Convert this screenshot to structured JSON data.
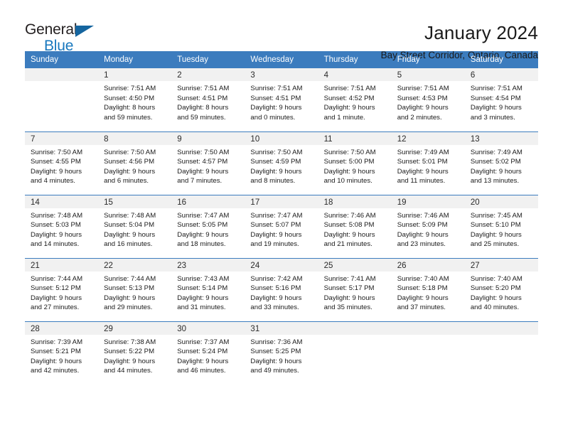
{
  "brand": {
    "name_part1": "General",
    "name_part2": "Blue",
    "triangle_color": "#15659f",
    "blue_color": "#1878be"
  },
  "header": {
    "title": "January 2024",
    "subtitle": "Bay Street Corridor, Ontario, Canada"
  },
  "theme": {
    "header_row_bg": "#3c7cbe",
    "daynum_bg": "#f1f1f1",
    "page_bg": "#ffffff"
  },
  "weekday_headers": [
    "Sunday",
    "Monday",
    "Tuesday",
    "Wednesday",
    "Thursday",
    "Friday",
    "Saturday"
  ],
  "weeks": [
    {
      "days": [
        {
          "num": "",
          "sunrise": "",
          "sunset": "",
          "daylight1": "",
          "daylight2": ""
        },
        {
          "num": "1",
          "sunrise": "Sunrise: 7:51 AM",
          "sunset": "Sunset: 4:50 PM",
          "daylight1": "Daylight: 8 hours",
          "daylight2": "and 59 minutes."
        },
        {
          "num": "2",
          "sunrise": "Sunrise: 7:51 AM",
          "sunset": "Sunset: 4:51 PM",
          "daylight1": "Daylight: 8 hours",
          "daylight2": "and 59 minutes."
        },
        {
          "num": "3",
          "sunrise": "Sunrise: 7:51 AM",
          "sunset": "Sunset: 4:51 PM",
          "daylight1": "Daylight: 9 hours",
          "daylight2": "and 0 minutes."
        },
        {
          "num": "4",
          "sunrise": "Sunrise: 7:51 AM",
          "sunset": "Sunset: 4:52 PM",
          "daylight1": "Daylight: 9 hours",
          "daylight2": "and 1 minute."
        },
        {
          "num": "5",
          "sunrise": "Sunrise: 7:51 AM",
          "sunset": "Sunset: 4:53 PM",
          "daylight1": "Daylight: 9 hours",
          "daylight2": "and 2 minutes."
        },
        {
          "num": "6",
          "sunrise": "Sunrise: 7:51 AM",
          "sunset": "Sunset: 4:54 PM",
          "daylight1": "Daylight: 9 hours",
          "daylight2": "and 3 minutes."
        }
      ]
    },
    {
      "days": [
        {
          "num": "7",
          "sunrise": "Sunrise: 7:50 AM",
          "sunset": "Sunset: 4:55 PM",
          "daylight1": "Daylight: 9 hours",
          "daylight2": "and 4 minutes."
        },
        {
          "num": "8",
          "sunrise": "Sunrise: 7:50 AM",
          "sunset": "Sunset: 4:56 PM",
          "daylight1": "Daylight: 9 hours",
          "daylight2": "and 6 minutes."
        },
        {
          "num": "9",
          "sunrise": "Sunrise: 7:50 AM",
          "sunset": "Sunset: 4:57 PM",
          "daylight1": "Daylight: 9 hours",
          "daylight2": "and 7 minutes."
        },
        {
          "num": "10",
          "sunrise": "Sunrise: 7:50 AM",
          "sunset": "Sunset: 4:59 PM",
          "daylight1": "Daylight: 9 hours",
          "daylight2": "and 8 minutes."
        },
        {
          "num": "11",
          "sunrise": "Sunrise: 7:50 AM",
          "sunset": "Sunset: 5:00 PM",
          "daylight1": "Daylight: 9 hours",
          "daylight2": "and 10 minutes."
        },
        {
          "num": "12",
          "sunrise": "Sunrise: 7:49 AM",
          "sunset": "Sunset: 5:01 PM",
          "daylight1": "Daylight: 9 hours",
          "daylight2": "and 11 minutes."
        },
        {
          "num": "13",
          "sunrise": "Sunrise: 7:49 AM",
          "sunset": "Sunset: 5:02 PM",
          "daylight1": "Daylight: 9 hours",
          "daylight2": "and 13 minutes."
        }
      ]
    },
    {
      "days": [
        {
          "num": "14",
          "sunrise": "Sunrise: 7:48 AM",
          "sunset": "Sunset: 5:03 PM",
          "daylight1": "Daylight: 9 hours",
          "daylight2": "and 14 minutes."
        },
        {
          "num": "15",
          "sunrise": "Sunrise: 7:48 AM",
          "sunset": "Sunset: 5:04 PM",
          "daylight1": "Daylight: 9 hours",
          "daylight2": "and 16 minutes."
        },
        {
          "num": "16",
          "sunrise": "Sunrise: 7:47 AM",
          "sunset": "Sunset: 5:05 PM",
          "daylight1": "Daylight: 9 hours",
          "daylight2": "and 18 minutes."
        },
        {
          "num": "17",
          "sunrise": "Sunrise: 7:47 AM",
          "sunset": "Sunset: 5:07 PM",
          "daylight1": "Daylight: 9 hours",
          "daylight2": "and 19 minutes."
        },
        {
          "num": "18",
          "sunrise": "Sunrise: 7:46 AM",
          "sunset": "Sunset: 5:08 PM",
          "daylight1": "Daylight: 9 hours",
          "daylight2": "and 21 minutes."
        },
        {
          "num": "19",
          "sunrise": "Sunrise: 7:46 AM",
          "sunset": "Sunset: 5:09 PM",
          "daylight1": "Daylight: 9 hours",
          "daylight2": "and 23 minutes."
        },
        {
          "num": "20",
          "sunrise": "Sunrise: 7:45 AM",
          "sunset": "Sunset: 5:10 PM",
          "daylight1": "Daylight: 9 hours",
          "daylight2": "and 25 minutes."
        }
      ]
    },
    {
      "days": [
        {
          "num": "21",
          "sunrise": "Sunrise: 7:44 AM",
          "sunset": "Sunset: 5:12 PM",
          "daylight1": "Daylight: 9 hours",
          "daylight2": "and 27 minutes."
        },
        {
          "num": "22",
          "sunrise": "Sunrise: 7:44 AM",
          "sunset": "Sunset: 5:13 PM",
          "daylight1": "Daylight: 9 hours",
          "daylight2": "and 29 minutes."
        },
        {
          "num": "23",
          "sunrise": "Sunrise: 7:43 AM",
          "sunset": "Sunset: 5:14 PM",
          "daylight1": "Daylight: 9 hours",
          "daylight2": "and 31 minutes."
        },
        {
          "num": "24",
          "sunrise": "Sunrise: 7:42 AM",
          "sunset": "Sunset: 5:16 PM",
          "daylight1": "Daylight: 9 hours",
          "daylight2": "and 33 minutes."
        },
        {
          "num": "25",
          "sunrise": "Sunrise: 7:41 AM",
          "sunset": "Sunset: 5:17 PM",
          "daylight1": "Daylight: 9 hours",
          "daylight2": "and 35 minutes."
        },
        {
          "num": "26",
          "sunrise": "Sunrise: 7:40 AM",
          "sunset": "Sunset: 5:18 PM",
          "daylight1": "Daylight: 9 hours",
          "daylight2": "and 37 minutes."
        },
        {
          "num": "27",
          "sunrise": "Sunrise: 7:40 AM",
          "sunset": "Sunset: 5:20 PM",
          "daylight1": "Daylight: 9 hours",
          "daylight2": "and 40 minutes."
        }
      ]
    },
    {
      "days": [
        {
          "num": "28",
          "sunrise": "Sunrise: 7:39 AM",
          "sunset": "Sunset: 5:21 PM",
          "daylight1": "Daylight: 9 hours",
          "daylight2": "and 42 minutes."
        },
        {
          "num": "29",
          "sunrise": "Sunrise: 7:38 AM",
          "sunset": "Sunset: 5:22 PM",
          "daylight1": "Daylight: 9 hours",
          "daylight2": "and 44 minutes."
        },
        {
          "num": "30",
          "sunrise": "Sunrise: 7:37 AM",
          "sunset": "Sunset: 5:24 PM",
          "daylight1": "Daylight: 9 hours",
          "daylight2": "and 46 minutes."
        },
        {
          "num": "31",
          "sunrise": "Sunrise: 7:36 AM",
          "sunset": "Sunset: 5:25 PM",
          "daylight1": "Daylight: 9 hours",
          "daylight2": "and 49 minutes."
        },
        {
          "num": "",
          "sunrise": "",
          "sunset": "",
          "daylight1": "",
          "daylight2": ""
        },
        {
          "num": "",
          "sunrise": "",
          "sunset": "",
          "daylight1": "",
          "daylight2": ""
        },
        {
          "num": "",
          "sunrise": "",
          "sunset": "",
          "daylight1": "",
          "daylight2": ""
        }
      ]
    }
  ]
}
